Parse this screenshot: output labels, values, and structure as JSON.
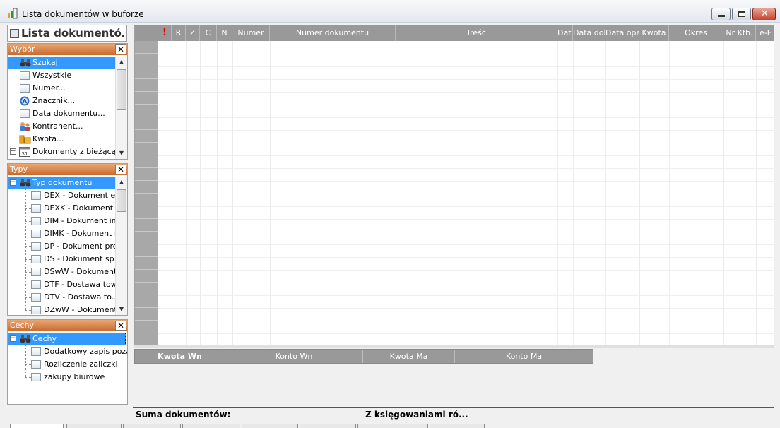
{
  "window": {
    "title": "Lista dokumentów w buforze",
    "close_glyph": "✕"
  },
  "left": {
    "header": "Lista dokumentó…"
  },
  "wybor": {
    "title": "Wybór",
    "close": "✕",
    "items": [
      {
        "label": "Szukaj",
        "icon": "binoculars-icon"
      },
      {
        "label": "Wszystkie",
        "icon": "list-icon"
      },
      {
        "label": "Numer...",
        "icon": "list-icon"
      },
      {
        "label": "Znacznik...",
        "icon": "marker-a-icon"
      },
      {
        "label": "Data dokumentu...",
        "icon": "list-icon"
      },
      {
        "label": "Kontrahent...",
        "icon": "people-icon"
      },
      {
        "label": "Kwota...",
        "icon": "coins-icon"
      },
      {
        "label": "Dokumenty z bieżącą ...",
        "icon": "calendar-icon"
      }
    ]
  },
  "typy": {
    "title": "Typy",
    "close": "✕",
    "root": "Typ dokumentu",
    "items": [
      "DEX - Dokument e...",
      "DEXK - Dokument ...",
      "DIM - Dokument im...",
      "DIMK - Dokument i...",
      "DP - Dokument pro...",
      "DS - Dokument sp...",
      "DSwW - Dokument...",
      "DTF - Dostawa tow...",
      "DTV - Dostawa to...",
      "DZwW - Dokument..."
    ]
  },
  "cechy": {
    "title": "Cechy",
    "close": "✕",
    "root": "Cechy",
    "items": [
      "Dodatkowy zapis poza...",
      "Rozliczenie zaliczki",
      "zakupy biurowe"
    ]
  },
  "grid": {
    "columns": [
      "!",
      "R",
      "Z",
      "C",
      "N",
      "Numer",
      "Numer dokumentu",
      "Treść",
      "Data",
      "Data dok",
      "Data ope",
      "Kwota",
      "Okres",
      "Nr Kth.",
      "e-F"
    ]
  },
  "postings": {
    "columns": [
      "Kwota Wn",
      "Konto Wn",
      "Kwota Ma",
      "Konto Ma"
    ]
  },
  "summary": {
    "label": "Suma dokumentów:",
    "right": "Z księgowaniami ró..."
  },
  "colors": {
    "accent_orange": "#c86a2c",
    "selection_blue": "#3399ff",
    "grid_header": "#999999",
    "alert_red": "#e00000"
  }
}
